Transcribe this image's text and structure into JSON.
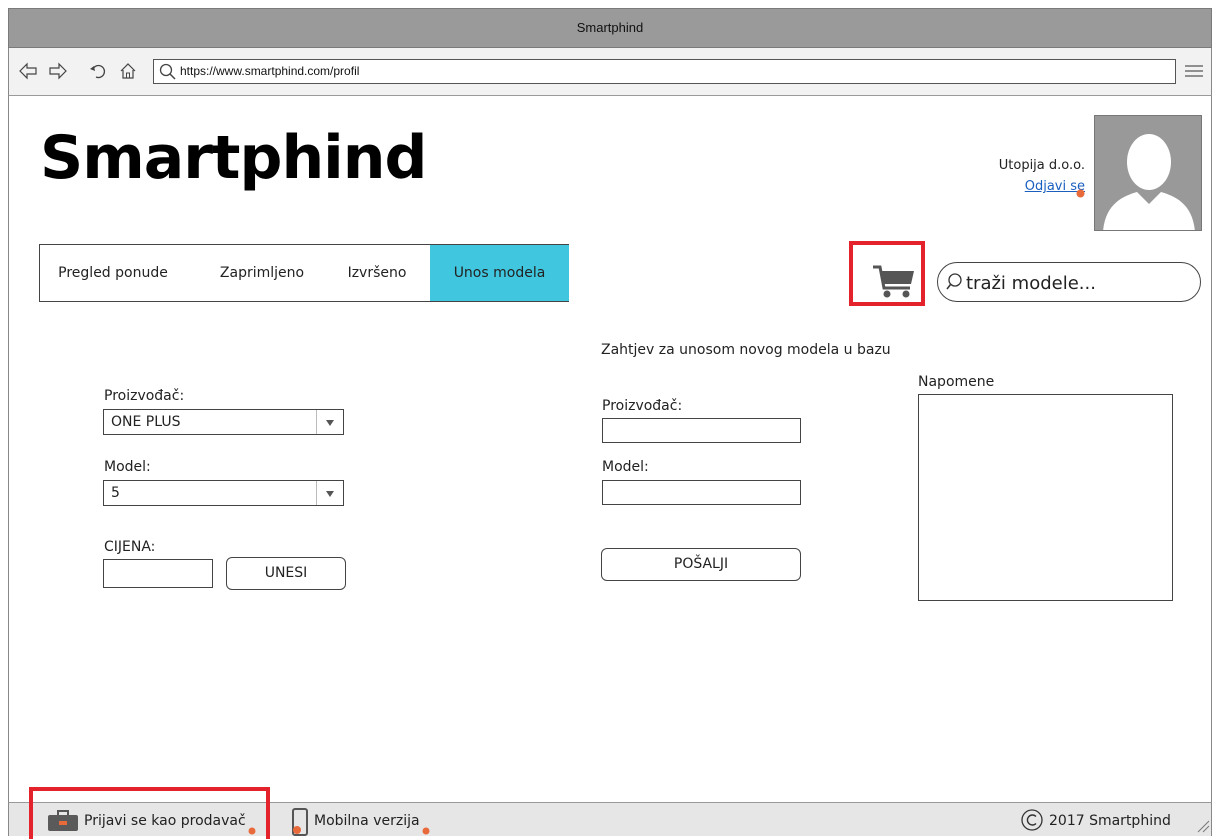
{
  "window": {
    "title": "Smartphind"
  },
  "browser": {
    "url": "https://www.smartphind.com/profil"
  },
  "header": {
    "brand": "Smartphind",
    "user_name": "Utopija d.o.o.",
    "logout_label": "Odjavi se"
  },
  "tabs": [
    {
      "label": "Pregled ponude",
      "active": false
    },
    {
      "label": "Zaprimljeno",
      "active": false
    },
    {
      "label": "Izvršeno",
      "active": false
    },
    {
      "label": "Unos modela",
      "active": true
    }
  ],
  "search": {
    "placeholder": "traži modele..."
  },
  "left_form": {
    "manufacturer_label": "Proizvođač:",
    "manufacturer_value": "ONE PLUS",
    "model_label": "Model:",
    "model_value": "5",
    "price_label": "CIJENA:",
    "price_value": "",
    "submit_label": "UNESI"
  },
  "request_form": {
    "heading": "Zahtjev za unosom novog modela u bazu",
    "manufacturer_label": "Proizvođač:",
    "model_label": "Model:",
    "submit_label": "POŠALJI",
    "notes_label": "Napomene"
  },
  "statusbar": {
    "seller_login": "Prijavi se kao prodavač",
    "mobile_version": "Mobilna verzija",
    "copyright": "2017 Smartphind"
  },
  "colors": {
    "active_tab": "#40c7df",
    "highlight": "#e4222c",
    "link": "#1a5fbf"
  }
}
